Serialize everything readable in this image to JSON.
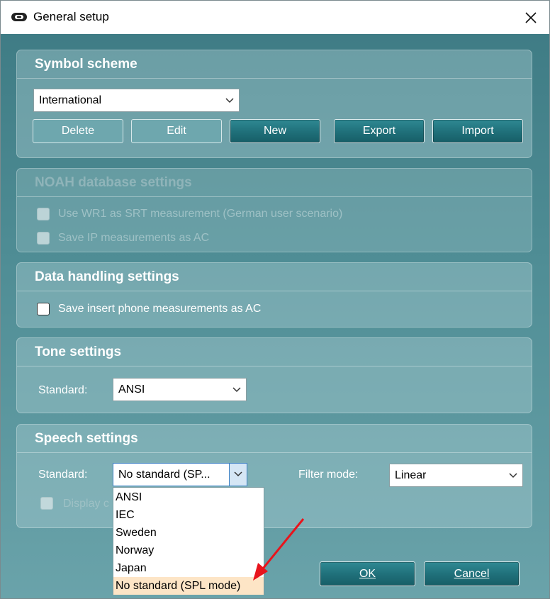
{
  "window": {
    "title": "General setup"
  },
  "symbol_scheme": {
    "title": "Symbol scheme",
    "selected": "International",
    "buttons": {
      "delete": "Delete",
      "edit": "Edit",
      "new": "New",
      "export": "Export",
      "import": "Import"
    }
  },
  "noah": {
    "title": "NOAH database settings",
    "options": [
      {
        "label": "Use WR1 as SRT measurement (German user scenario)",
        "checked": false,
        "enabled": false
      },
      {
        "label": "Save IP measurements as AC",
        "checked": false,
        "enabled": false
      }
    ]
  },
  "data_handling": {
    "title": "Data handling settings",
    "options": [
      {
        "label": "Save insert phone measurements as AC",
        "checked": false,
        "enabled": true
      }
    ]
  },
  "tone": {
    "title": "Tone settings",
    "standard_label": "Standard:",
    "standard_value": "ANSI"
  },
  "speech": {
    "title": "Speech settings",
    "standard_label": "Standard:",
    "standard_value": "No standard (SP...",
    "filter_label": "Filter mode:",
    "filter_value": "Linear",
    "display_label": "Display c",
    "standard_options": [
      "ANSI",
      "IEC",
      "Sweden",
      "Norway",
      "Japan",
      "No standard (SPL mode)"
    ],
    "selected_option": "No standard (SPL mode)"
  },
  "footer": {
    "ok": "OK",
    "cancel": "Cancel"
  },
  "colors": {
    "accent": "#1f6f79",
    "annotation_arrow": "#e8141c",
    "selection": "#fde5c6"
  }
}
